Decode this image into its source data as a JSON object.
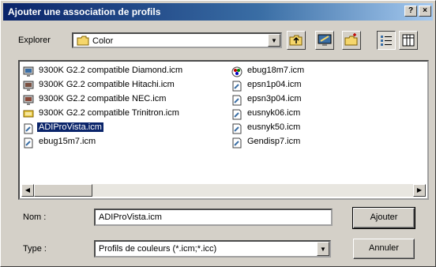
{
  "window": {
    "title": "Ajouter une association de profils",
    "help_label": "?",
    "close_label": "×"
  },
  "lookin": {
    "label": "Explorer",
    "value": "Color"
  },
  "files_col1": [
    {
      "name": "9300K G2.2 compatible Diamond.icm",
      "icon": "monitor-profile-icon",
      "selected": false
    },
    {
      "name": "9300K G2.2 compatible Hitachi.icm",
      "icon": "monitor-profile-icon",
      "selected": false
    },
    {
      "name": "9300K G2.2 compatible NEC.icm",
      "icon": "monitor-profile-icon",
      "selected": false
    },
    {
      "name": "9300K G2.2 compatible Trinitron.icm",
      "icon": "monitor-profile-icon",
      "selected": false
    },
    {
      "name": "ADIProVista.icm",
      "icon": "profile-icon",
      "selected": true
    },
    {
      "name": "ebug15m7.icm",
      "icon": "profile-icon",
      "selected": false
    }
  ],
  "files_col2": [
    {
      "name": "ebug18m7.icm",
      "icon": "color-profile-icon",
      "selected": false
    },
    {
      "name": "epsn1p04.icm",
      "icon": "profile-icon",
      "selected": false
    },
    {
      "name": "epsn3p04.icm",
      "icon": "profile-icon",
      "selected": false
    },
    {
      "name": "eusnyk06.icm",
      "icon": "profile-icon",
      "selected": false
    },
    {
      "name": "eusnyk50.icm",
      "icon": "profile-icon",
      "selected": false
    },
    {
      "name": "Gendisp7.icm",
      "icon": "profile-icon",
      "selected": false
    }
  ],
  "filename": {
    "label": "Nom :",
    "value": "ADIProVista.icm"
  },
  "filetype": {
    "label": "Type :",
    "value": "Profils de couleurs (*.icm;*.icc)"
  },
  "buttons": {
    "ok": "Ajouter",
    "cancel": "Annuler"
  },
  "colors": {
    "titlebar_start": "#0a246a",
    "titlebar_end": "#a6caf0",
    "selection": "#0a246a",
    "face": "#d4d0c8"
  }
}
